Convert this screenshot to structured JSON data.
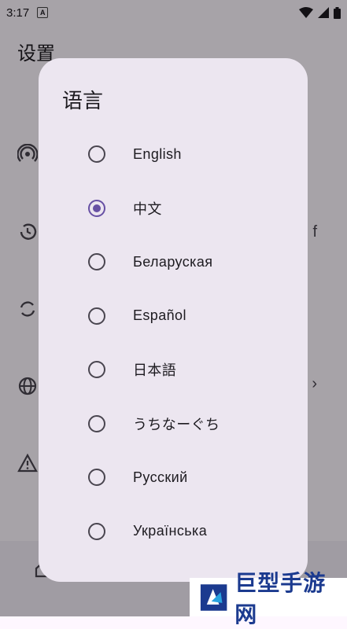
{
  "status_bar": {
    "time": "3:17",
    "notification_icon": "A"
  },
  "app_bar": {
    "title": "设置"
  },
  "background": {
    "partial_text": "f"
  },
  "dialog": {
    "title": "语言",
    "options": [
      {
        "label": "English",
        "selected": false
      },
      {
        "label": "中文",
        "selected": true
      },
      {
        "label": "Беларуская",
        "selected": false
      },
      {
        "label": "Español",
        "selected": false
      },
      {
        "label": "日本語",
        "selected": false
      },
      {
        "label": "うちなーぐち",
        "selected": false
      },
      {
        "label": "Русский",
        "selected": false
      },
      {
        "label": "Українська",
        "selected": false
      }
    ]
  },
  "watermark": {
    "text": "巨型手游网"
  },
  "colors": {
    "accent": "#6750a4",
    "dialog_bg": "#ece6f0",
    "watermark_text": "#1b3a8f"
  }
}
